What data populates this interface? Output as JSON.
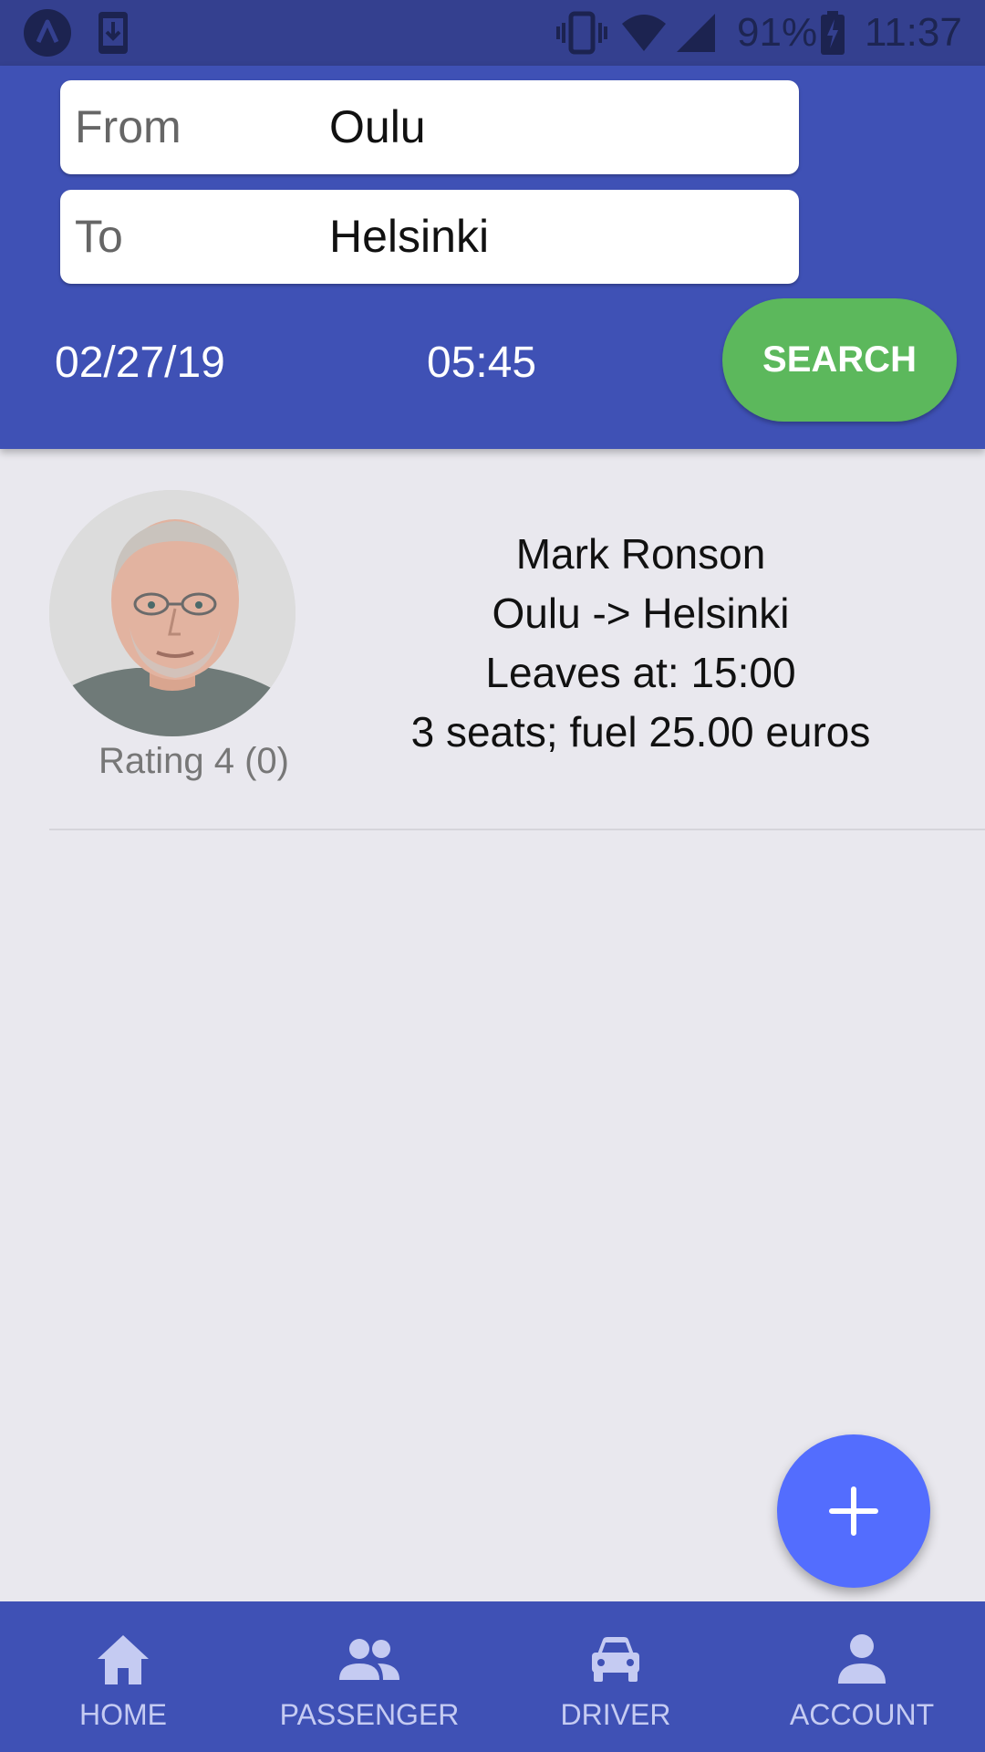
{
  "status_bar": {
    "battery": "91%",
    "time": "11:37",
    "icons": [
      "app-notification-icon",
      "download-icon",
      "vibrate-icon",
      "wifi-icon",
      "signal-icon",
      "battery-charging-icon"
    ]
  },
  "search": {
    "from_label": "From",
    "from_value": "Oulu",
    "to_label": "To",
    "to_value": "Helsinki",
    "date": "02/27/19",
    "time": "05:45",
    "search_label": "SEARCH"
  },
  "rides": [
    {
      "driver_name": "Mark Ronson",
      "route": "Oulu -> Helsinki",
      "leaves": "Leaves at: 15:00",
      "seats_fuel": "3 seats; fuel 25.00 euros",
      "rating": "Rating 4 (0)"
    }
  ],
  "fab": {
    "icon": "plus-icon"
  },
  "bottom_nav": [
    {
      "label": "HOME",
      "icon": "home-icon"
    },
    {
      "label": "PASSENGER",
      "icon": "people-icon"
    },
    {
      "label": "DRIVER",
      "icon": "car-icon"
    },
    {
      "label": "ACCOUNT",
      "icon": "person-icon"
    }
  ],
  "colors": {
    "primary": "#3f51b5",
    "status_bar": "#34408f",
    "search_button": "#5cb85c",
    "fab": "#536dfe",
    "background": "#e9e8ee"
  }
}
